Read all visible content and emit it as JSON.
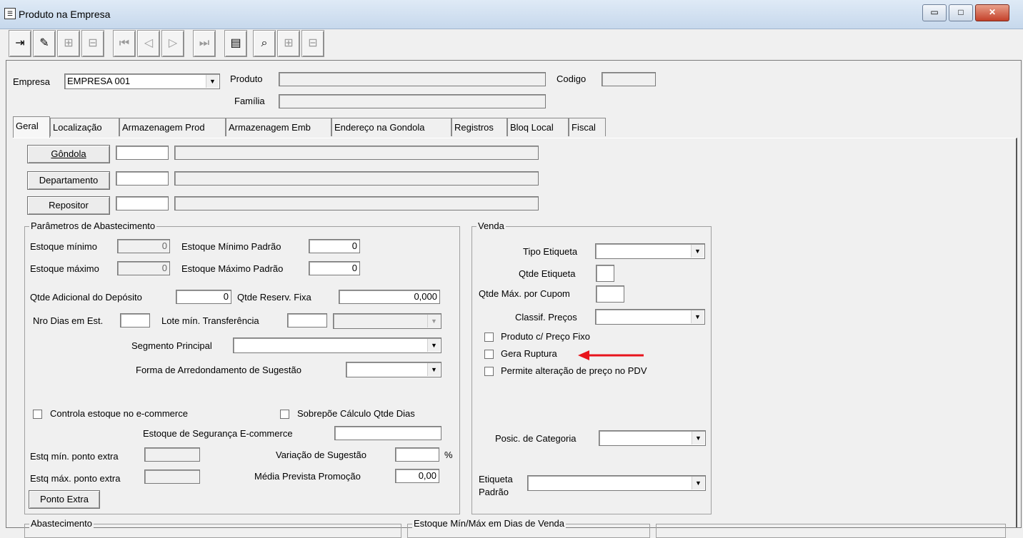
{
  "window": {
    "title": "Produto na Empresa",
    "minimize": "▭",
    "maximize": "□",
    "close": "✕"
  },
  "toolbar": [
    {
      "name": "exit-icon",
      "glyph": "⇥",
      "active": true
    },
    {
      "name": "eraser-icon",
      "glyph": "✎",
      "active": true
    },
    {
      "name": "insert-icon",
      "glyph": "⊞",
      "active": false
    },
    {
      "name": "delete-icon",
      "glyph": "⊟",
      "active": false
    },
    {
      "name": "first-record-icon",
      "glyph": "⏮",
      "active": false
    },
    {
      "name": "prev-record-icon",
      "glyph": "◁",
      "active": false
    },
    {
      "name": "next-record-icon",
      "glyph": "▷",
      "active": false
    },
    {
      "name": "last-record-icon",
      "glyph": "⏭",
      "active": false
    },
    {
      "name": "list-icon",
      "glyph": "▤",
      "active": true
    },
    {
      "name": "binoculars-icon",
      "glyph": "⌕",
      "active": true
    },
    {
      "name": "grid-add-icon",
      "glyph": "⊞",
      "active": false
    },
    {
      "name": "grid-remove-icon",
      "glyph": "⊟",
      "active": false
    }
  ],
  "header": {
    "empresa_label": "Empresa",
    "empresa_value": "EMPRESA 001",
    "produto_label": "Produto",
    "produto_value": "",
    "codigo_label": "Codigo",
    "codigo_value": "",
    "familia_label": "Família",
    "familia_value": ""
  },
  "tabs": [
    "Geral",
    "Localização",
    "Armazenagem Prod",
    "Armazenagem Emb",
    "Endereço na Gondola",
    "Registros",
    "Bloq Local",
    "Fiscal"
  ],
  "geral": {
    "gondola_btn": "Gôndola",
    "departamento_btn": "Departamento",
    "repositor_btn": "Repositor"
  },
  "abastecimento": {
    "title": "Parâmetros de Abastecimento",
    "estoque_minimo_label": "Estoque mínimo",
    "estoque_minimo": "0",
    "estoque_minimo_padrao_label": "Estoque Mínimo Padrão",
    "estoque_minimo_padrao": "0",
    "estoque_maximo_label": "Estoque máximo",
    "estoque_maximo": "0",
    "estoque_maximo_padrao_label": "Estoque Máximo Padrão",
    "estoque_maximo_padrao": "0",
    "qtde_adicional_label": "Qtde Adicional do Depósito",
    "qtde_adicional": "0",
    "qtde_reserv_label": "Qtde Reserv. Fixa",
    "qtde_reserv": "0,000",
    "nro_dias_label": "Nro Dias em Est.",
    "lote_min_label": "Lote mín. Transferência",
    "segmento_label": "Segmento Principal",
    "forma_arred_label": "Forma de Arredondamento de Sugestão",
    "controla_ecommerce_label": "Controla estoque no e-commerce",
    "sobrepoe_label": "Sobrepõe Cálculo Qtde Dias",
    "estoque_seg_label": "Estoque de Segurança E-commerce",
    "estq_min_extra_label": "Estq mín. ponto extra",
    "variacao_label": "Variação de Sugestão",
    "percent": "%",
    "estq_max_extra_label": "Estq máx. ponto extra",
    "media_prevista_label": "Média Prevista Promoção",
    "media_prevista": "0,00",
    "ponto_extra_btn": "Ponto Extra"
  },
  "venda": {
    "title": "Venda",
    "tipo_etiqueta_label": "Tipo Etiqueta",
    "qtde_etiqueta_label": "Qtde Etiqueta",
    "qtde_max_cupom_label": "Qtde Máx. por Cupom",
    "classif_precos_label": "Classif. Preços",
    "preco_fixo_label": "Produto c/ Preço Fixo",
    "gera_ruptura_label": "Gera Ruptura",
    "permite_alteracao_label": "Permite alteração de preço no PDV",
    "posic_categoria_label": "Posic. de Categoria",
    "etiqueta_label_1": "Etiqueta",
    "etiqueta_label_2": "Padrão"
  },
  "bottom_groups": {
    "abastecimento_title": "Abastecimento",
    "estoque_minmax_title": "Estoque Mín/Máx em Dias de Venda"
  },
  "colors": {
    "arrow": "#e8141c"
  }
}
